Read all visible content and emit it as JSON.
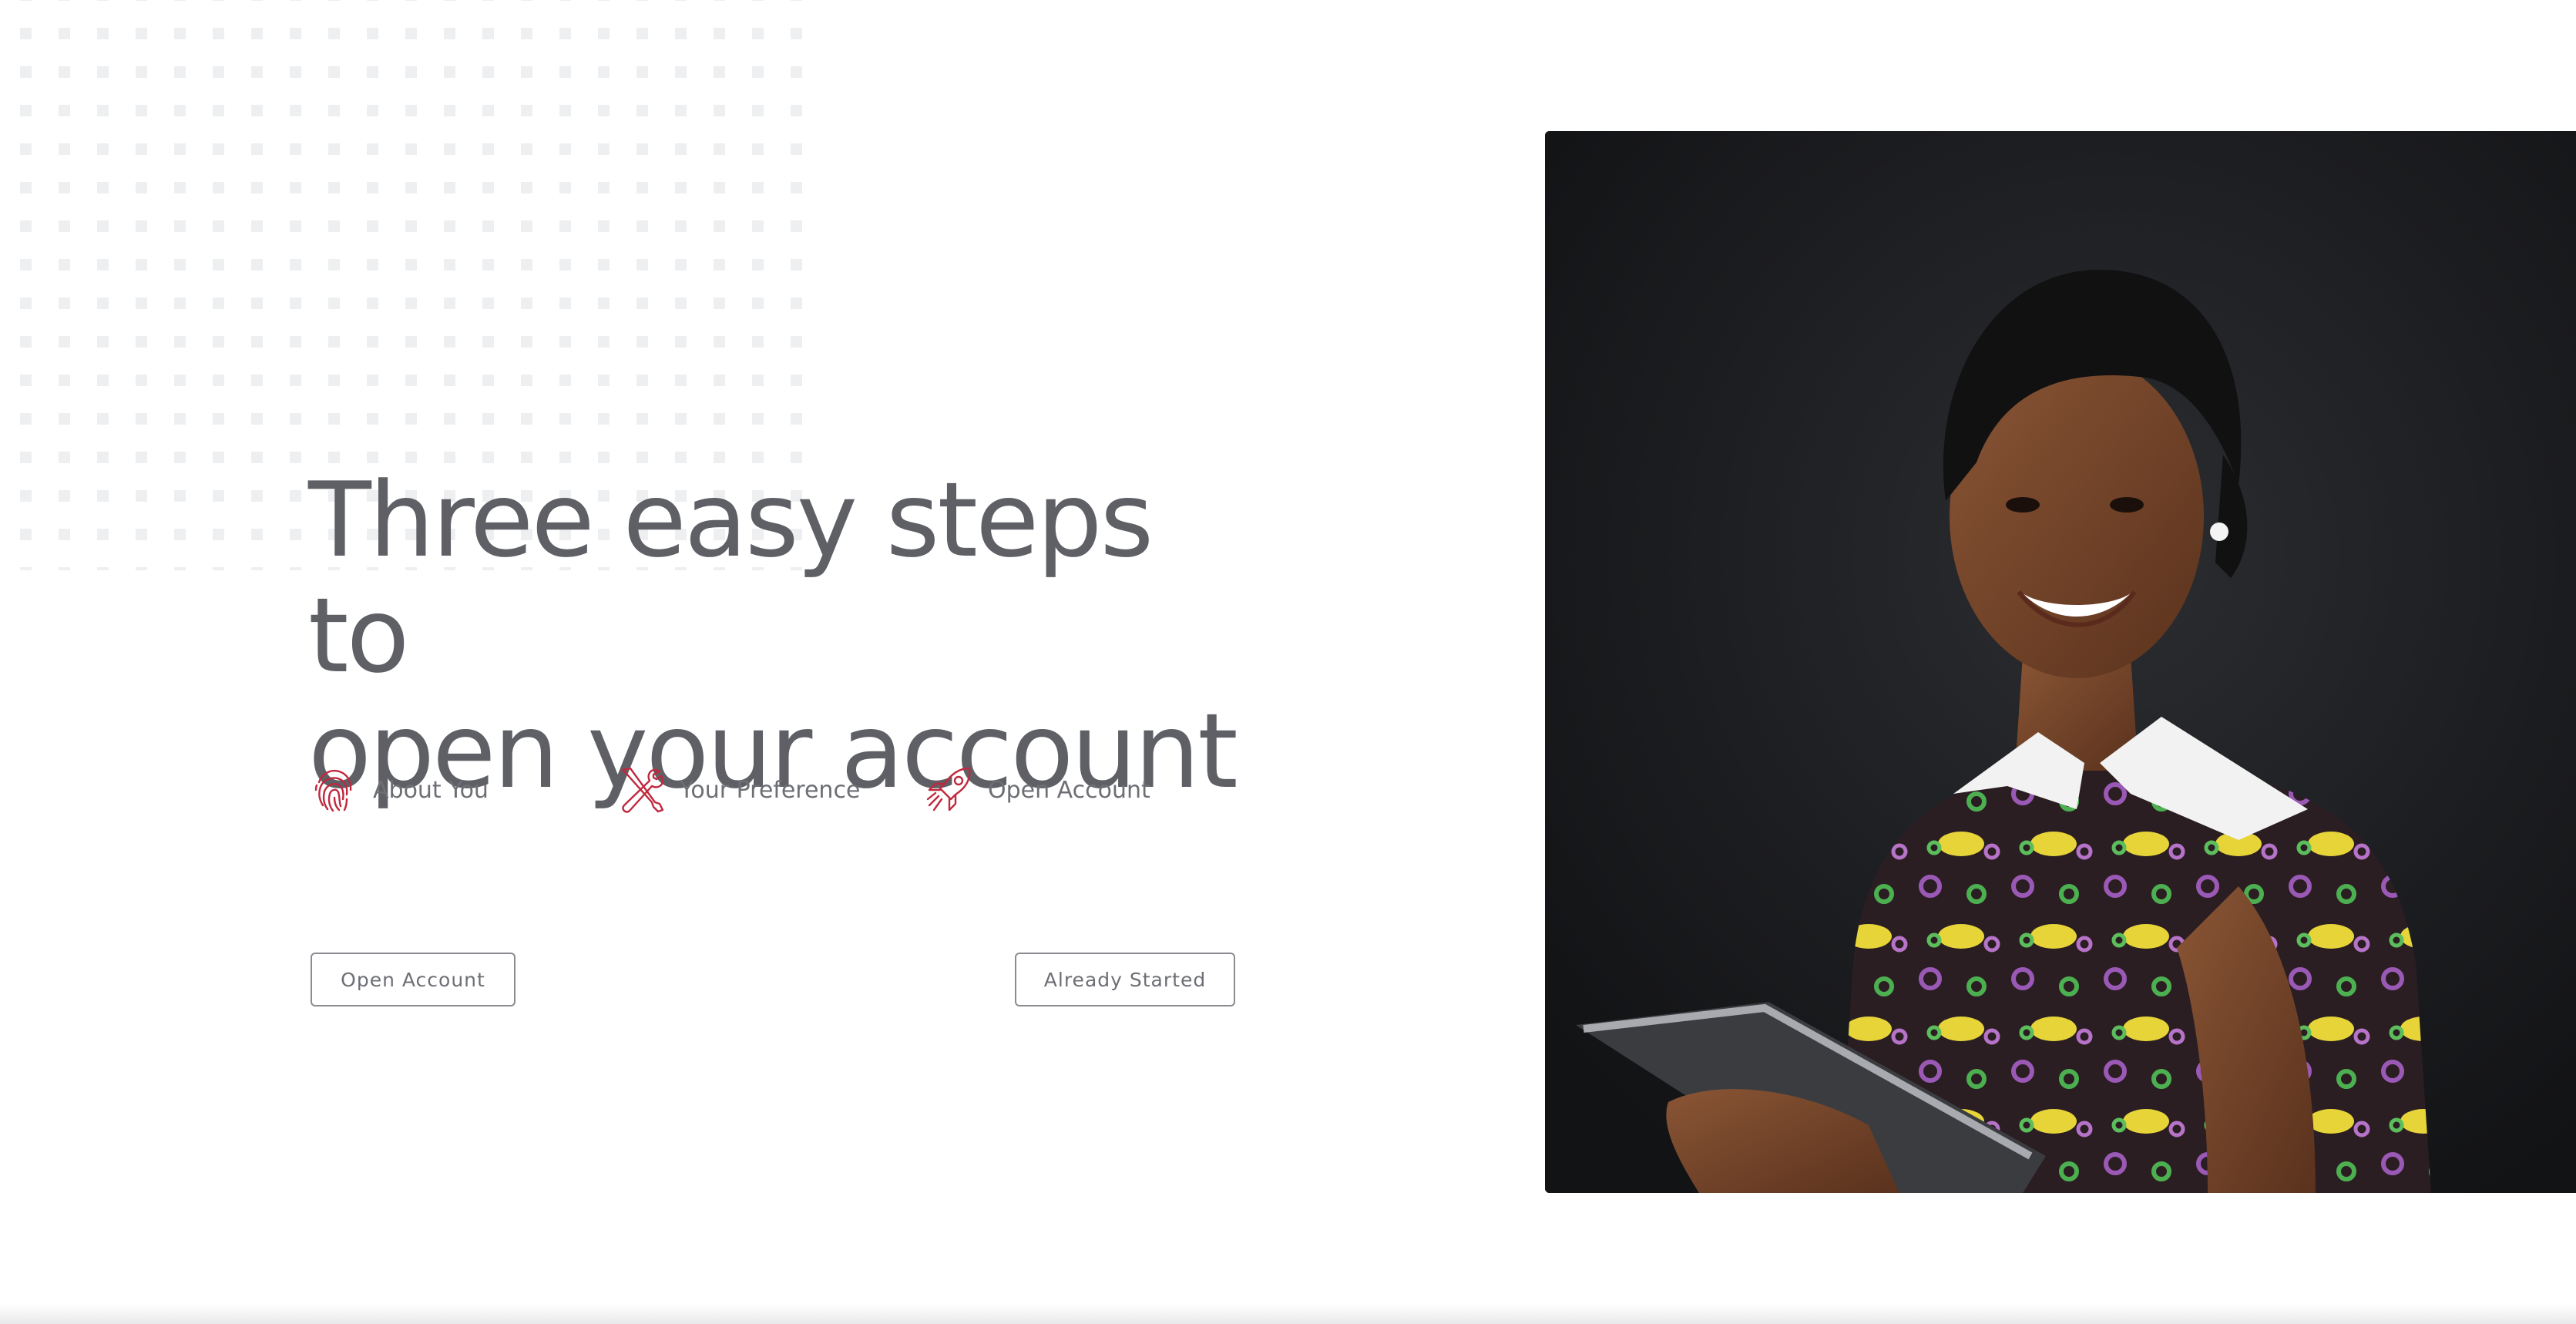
{
  "hero": {
    "headline_line1": "Three easy steps to",
    "headline_line2": "open your account"
  },
  "steps": [
    {
      "label": "About You",
      "icon": "fingerprint-icon"
    },
    {
      "label": "Your Preference",
      "icon": "tools-icon"
    },
    {
      "label": "Open Account",
      "icon": "rocket-icon"
    }
  ],
  "buttons": {
    "open_account": "Open Account",
    "already_started": "Already Started"
  },
  "colors": {
    "accent": "#c0283e",
    "text": "#5e6066",
    "button_border": "#8a8c92"
  }
}
